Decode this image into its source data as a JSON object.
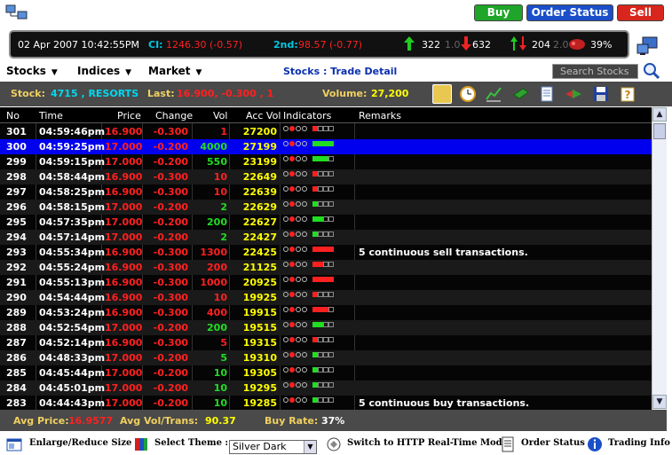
{
  "header": {
    "buy_label": "Buy",
    "order_status_label": "Order Status",
    "sell_label": "Sell"
  },
  "ticker": {
    "datetime": "02 Apr 2007 10:42:55PM",
    "ci_label": "CI:",
    "ci_value": "1246.30 (-0.57)",
    "second_label": "2nd:",
    "second_value": "98.57 (-0.77)",
    "up_count": "322",
    "unch_count": "1.0",
    "down_count": "632",
    "vol_up": "204",
    "vol_mid": "2.0",
    "pct": "39%"
  },
  "menu": {
    "stocks": "Stocks",
    "indices": "Indices",
    "market": "Market",
    "breadcrumb": "Stocks : Trade Detail",
    "search_placeholder": "Search Stocks"
  },
  "info": {
    "stock_label": "Stock:",
    "stock_value": "4715 , RESORTS",
    "last_label": "Last:",
    "last_value": "16.900, -0.300 , 1",
    "volume_label": "Volume:",
    "volume_value": "27,200"
  },
  "table": {
    "columns": [
      "No",
      "Time",
      "Price",
      "Change",
      "Vol",
      "Acc Vol",
      "Indicators",
      "Remarks"
    ],
    "rows": [
      {
        "no": "301",
        "time": "04:59:46pm",
        "price": "16.900",
        "change": "-0.300",
        "vol": "1",
        "acc": "27200",
        "dot": 1,
        "bars": "r---",
        "remark": ""
      },
      {
        "no": "300",
        "time": "04:59:25pm",
        "price": "17.000",
        "change": "-0.200",
        "vol": "4000",
        "acc": "27199",
        "dot": 1,
        "bars": "gggg",
        "remark": "",
        "selected": true
      },
      {
        "no": "299",
        "time": "04:59:15pm",
        "price": "17.000",
        "change": "-0.200",
        "vol": "550",
        "acc": "23199",
        "dot": 1,
        "bars": "ggg-",
        "remark": ""
      },
      {
        "no": "298",
        "time": "04:58:44pm",
        "price": "16.900",
        "change": "-0.300",
        "vol": "10",
        "acc": "22649",
        "dot": 1,
        "bars": "r---",
        "remark": ""
      },
      {
        "no": "297",
        "time": "04:58:25pm",
        "price": "16.900",
        "change": "-0.300",
        "vol": "10",
        "acc": "22639",
        "dot": 1,
        "bars": "r---",
        "remark": ""
      },
      {
        "no": "296",
        "time": "04:58:15pm",
        "price": "17.000",
        "change": "-0.200",
        "vol": "2",
        "acc": "22629",
        "dot": 1,
        "bars": "g---",
        "remark": ""
      },
      {
        "no": "295",
        "time": "04:57:35pm",
        "price": "17.000",
        "change": "-0.200",
        "vol": "200",
        "acc": "22627",
        "dot": 1,
        "bars": "gg--",
        "remark": ""
      },
      {
        "no": "294",
        "time": "04:57:14pm",
        "price": "17.000",
        "change": "-0.200",
        "vol": "2",
        "acc": "22427",
        "dot": 1,
        "bars": "g---",
        "remark": ""
      },
      {
        "no": "293",
        "time": "04:55:34pm",
        "price": "16.900",
        "change": "-0.300",
        "vol": "1300",
        "acc": "22425",
        "dot": 1,
        "bars": "rrrr",
        "remark": "5 continuous sell transactions."
      },
      {
        "no": "292",
        "time": "04:55:24pm",
        "price": "16.900",
        "change": "-0.300",
        "vol": "200",
        "acc": "21125",
        "dot": 1,
        "bars": "rr--",
        "remark": ""
      },
      {
        "no": "291",
        "time": "04:55:13pm",
        "price": "16.900",
        "change": "-0.300",
        "vol": "1000",
        "acc": "20925",
        "dot": 1,
        "bars": "rrrr",
        "remark": ""
      },
      {
        "no": "290",
        "time": "04:54:44pm",
        "price": "16.900",
        "change": "-0.300",
        "vol": "10",
        "acc": "19925",
        "dot": 1,
        "bars": "r---",
        "remark": ""
      },
      {
        "no": "289",
        "time": "04:53:24pm",
        "price": "16.900",
        "change": "-0.300",
        "vol": "400",
        "acc": "19915",
        "dot": 1,
        "bars": "rrr-",
        "remark": ""
      },
      {
        "no": "288",
        "time": "04:52:54pm",
        "price": "17.000",
        "change": "-0.200",
        "vol": "200",
        "acc": "19515",
        "dot": 1,
        "bars": "gg--",
        "remark": ""
      },
      {
        "no": "287",
        "time": "04:52:14pm",
        "price": "16.900",
        "change": "-0.300",
        "vol": "5",
        "acc": "19315",
        "dot": 1,
        "bars": "r---",
        "remark": ""
      },
      {
        "no": "286",
        "time": "04:48:33pm",
        "price": "17.000",
        "change": "-0.200",
        "vol": "5",
        "acc": "19310",
        "dot": 1,
        "bars": "g---",
        "remark": ""
      },
      {
        "no": "285",
        "time": "04:45:44pm",
        "price": "17.000",
        "change": "-0.200",
        "vol": "10",
        "acc": "19305",
        "dot": 1,
        "bars": "g---",
        "remark": ""
      },
      {
        "no": "284",
        "time": "04:45:01pm",
        "price": "17.000",
        "change": "-0.200",
        "vol": "10",
        "acc": "19295",
        "dot": 1,
        "bars": "g---",
        "remark": ""
      },
      {
        "no": "283",
        "time": "04:44:43pm",
        "price": "17.000",
        "change": "-0.200",
        "vol": "10",
        "acc": "19285",
        "dot": 1,
        "bars": "g---",
        "remark": "5 continuous buy transactions."
      }
    ]
  },
  "status": {
    "avg_price_label": "Avg Price:",
    "avg_price_value": "16.9577",
    "avg_vol_label": "Avg Vol/Trans:",
    "avg_vol_value": "90.37",
    "buy_rate_label": "Buy Rate:",
    "buy_rate_value": "37%"
  },
  "bottom": {
    "enlarge_label": "Enlarge/Reduce Size",
    "theme_label": "Select Theme :",
    "theme_value": "Silver Dark",
    "http_label": "Switch to HTTP Real-Time Mode",
    "order_status_label": "Order Status",
    "trading_info_label": "Trading Info"
  },
  "colors": {
    "buy": "#1fa52a",
    "order_status": "#1b4fc9",
    "sell": "#d8261c",
    "up": "#22dd22",
    "down": "#ff2020",
    "accent_cyan": "#00c8e0",
    "accent_yellow": "#ffff00"
  }
}
